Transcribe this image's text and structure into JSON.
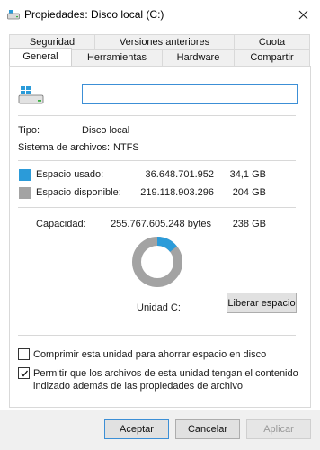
{
  "window": {
    "title": "Propiedades: Disco local (C:)",
    "icons": {
      "title": "drive-icon",
      "close": "close-icon"
    }
  },
  "tabs": {
    "back": [
      {
        "label": "Seguridad"
      },
      {
        "label": "Versiones anteriores"
      },
      {
        "label": "Cuota"
      }
    ],
    "front": [
      {
        "label": "General",
        "active": true
      },
      {
        "label": "Herramientas"
      },
      {
        "label": "Hardware"
      },
      {
        "label": "Compartir"
      }
    ]
  },
  "general": {
    "volume_name_value": "",
    "type_label": "Tipo:",
    "type_value": "Disco local",
    "fs_label": "Sistema de archivos:",
    "fs_value": "NTFS",
    "used": {
      "label": "Espacio usado:",
      "bytes": "36.648.701.952",
      "size": "34,1 GB",
      "color": "#2b9bd9"
    },
    "free": {
      "label": "Espacio disponible:",
      "bytes": "219.118.903.296",
      "size": "204 GB",
      "color": "#a3a3a3"
    },
    "capacity": {
      "label": "Capacidad:",
      "bytes": "255.767.605.248 bytes",
      "size": "238 GB"
    },
    "used_fraction": 0.143,
    "drive_label": "Unidad C:",
    "cleanup_button": "Liberar espacio",
    "compress_label": "Comprimir esta unidad para ahorrar espacio en disco",
    "compress_checked": false,
    "index_label_line1": "Permitir que los archivos de esta unidad tengan el contenido",
    "index_label_line2": "indizado además de las propiedades de archivo",
    "index_checked": true
  },
  "buttons": {
    "ok": "Aceptar",
    "cancel": "Cancelar",
    "apply": "Aplicar"
  }
}
